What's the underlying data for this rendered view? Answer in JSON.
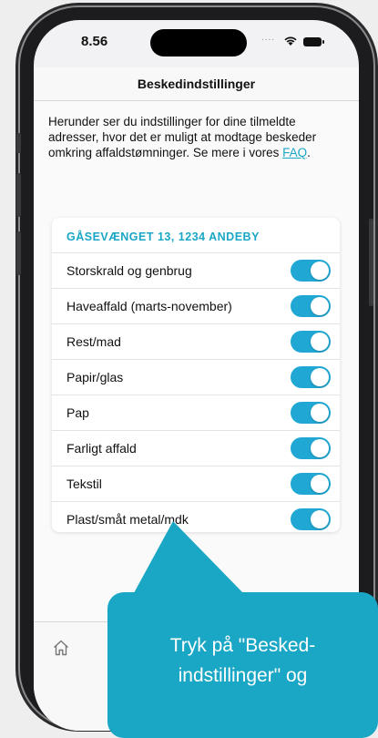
{
  "status": {
    "time": "8.56",
    "signal_dots": "....",
    "icons": [
      "wifi-icon",
      "battery-icon"
    ]
  },
  "navbar": {
    "title": "Beskedindstillinger"
  },
  "intro": {
    "text_before_link": "Herunder ser du indstillinger for dine tilmeldte adresser, hvor det er muligt at modtage beskeder omkring affaldstømninger. Se mere i vores ",
    "link_text": "FAQ",
    "text_after_link": "."
  },
  "address_card": {
    "header": "GÅSEVÆNGET 13, 1234 ANDEBY",
    "settings": [
      {
        "label": "Storskrald og genbrug",
        "enabled": true
      },
      {
        "label": "Haveaffald (marts-november)",
        "enabled": true
      },
      {
        "label": "Rest/mad",
        "enabled": true
      },
      {
        "label": "Papir/glas",
        "enabled": true
      },
      {
        "label": "Pap",
        "enabled": true
      },
      {
        "label": "Farligt affald",
        "enabled": true
      },
      {
        "label": "Tekstil",
        "enabled": true
      },
      {
        "label": "Plast/småt metal/mdk",
        "enabled": true
      }
    ]
  },
  "tabbar": {
    "icons": [
      "home-icon"
    ]
  },
  "callout": {
    "line1": "Tryk på \"Besked-",
    "line2": "indstillinger\" og"
  },
  "colors": {
    "accent": "#1aa6c5",
    "toggle_on": "#20a7d3",
    "callout_bg": "#1aa6c5"
  }
}
